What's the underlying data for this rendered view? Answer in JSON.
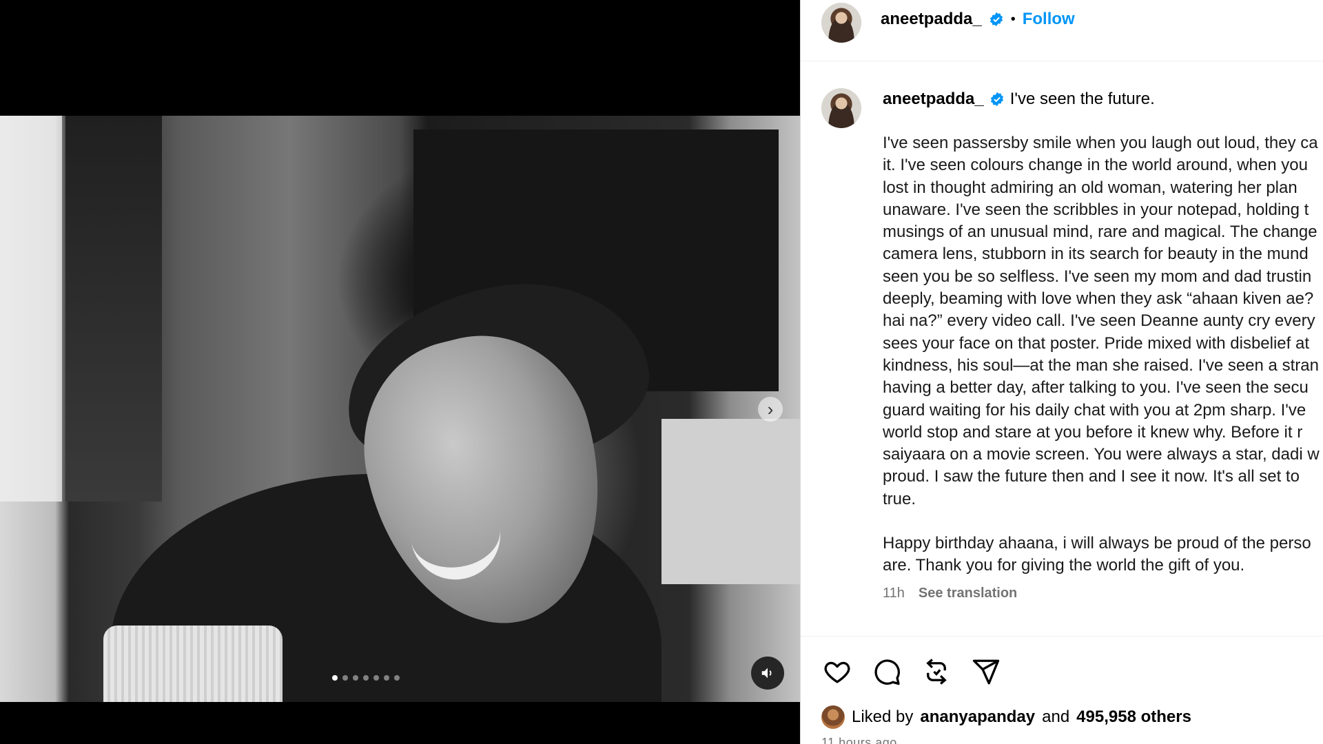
{
  "post": {
    "username": "aneetpadda_",
    "separator": "•",
    "follow_label": "Follow",
    "caption_title": "I've seen the future.",
    "caption_lines": [
      "I've seen passersby smile when you laugh out loud, they ca",
      "it. I've seen colours change in the world around, when you",
      "lost in thought admiring an old woman, watering her plan",
      "unaware. I've seen the scribbles in your notepad, holding t",
      "musings of an unusual mind, rare and magical. The change",
      "camera lens, stubborn in its search for beauty in the mund",
      "seen you be so selfless. I've seen my mom and dad trustin",
      "deeply, beaming with love when they ask “ahaan kiven ae?",
      "hai na?” every video call. I've seen Deanne aunty cry every",
      "sees your face on that poster. Pride mixed with disbelief at",
      "kindness, his soul—at the man she raised. I've seen a stran",
      "having a better day, after talking to you. I've seen the secu",
      "guard waiting for his daily chat with you at 2pm sharp. I've",
      "world stop and stare at you before it knew why. Before it r",
      "saiyaara on a movie screen. You were always a star, dadi w",
      "proud. I saw the future then and I see it now. It's all set to",
      "true."
    ],
    "caption_lines_2": [
      "Happy birthday ahaana, i will always be proud of the perso",
      "are. Thank you for giving the world the gift of you."
    ],
    "time_short": "11h",
    "see_translation": "See translation"
  },
  "likes": {
    "prefix": "Liked by",
    "user": "ananyapanday",
    "conj": "and",
    "count": "495,958 others"
  },
  "time_ago": "11 hours ago",
  "media": {
    "carousel_count": 7,
    "carousel_active_index": 0
  },
  "icons": {
    "like": "heart-icon",
    "comment": "comment-icon",
    "repost": "repost-icon",
    "share": "share-icon",
    "next": "chevron-right-icon",
    "audio": "speaker-icon",
    "verified": "verified-badge-icon"
  },
  "colors": {
    "follow": "#0095f6",
    "verified": "#0095f6",
    "muted_text": "#737373",
    "story_ring": "#e1306c"
  }
}
